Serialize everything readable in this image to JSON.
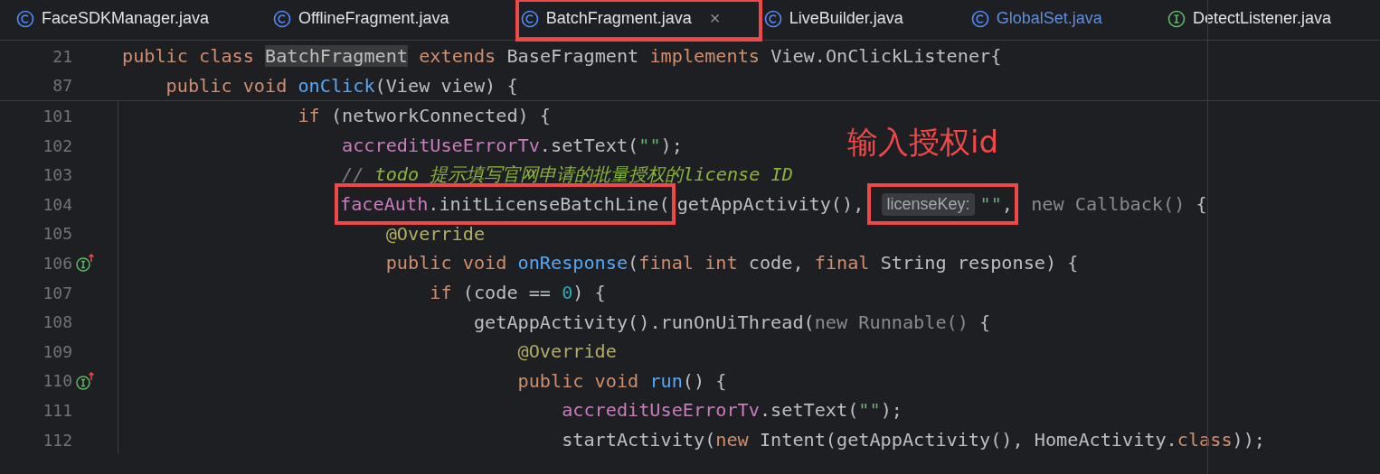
{
  "tabs": [
    {
      "label": "FaceSDKManager.java",
      "kind": "class",
      "selected": false,
      "modified": false,
      "annotated": false
    },
    {
      "label": "OfflineFragment.java",
      "kind": "class",
      "selected": false,
      "modified": false,
      "annotated": false
    },
    {
      "label": "BatchFragment.java",
      "kind": "class",
      "selected": true,
      "modified": false,
      "annotated": true,
      "close": "×"
    },
    {
      "label": "LiveBuilder.java",
      "kind": "class",
      "selected": false,
      "modified": false,
      "annotated": false
    },
    {
      "label": "GlobalSet.java",
      "kind": "class",
      "selected": false,
      "modified": true,
      "annotated": false
    },
    {
      "label": "DetectListener.java",
      "kind": "interface",
      "selected": false,
      "modified": false,
      "annotated": false
    }
  ],
  "sticky_lines": [
    {
      "number": "21",
      "tokens": [
        {
          "kind": "keyword",
          "text": "public class "
        },
        {
          "kind": "plain",
          "text": "BatchFragment",
          "highlighted": true
        },
        {
          "kind": "keyword",
          "text": " extends "
        },
        {
          "kind": "plain",
          "text": "BaseFragment"
        },
        {
          "kind": "keyword",
          "text": " implements "
        },
        {
          "kind": "plain",
          "text": "View.OnClickListener{"
        }
      ],
      "children": [
        {
          "number": "87",
          "tokens": [
            {
              "kind": "keyword",
              "text": "public void "
            },
            {
              "kind": "method",
              "text": "onClick"
            },
            {
              "kind": "plain",
              "text": "(View view) {"
            }
          ]
        }
      ]
    }
  ],
  "lines": [
    {
      "number": "101",
      "tokens": [
        {
          "kind": "keyword",
          "text": "if"
        },
        {
          "kind": "plain",
          "text": " (networkConnected) {"
        }
      ],
      "children": [
        {
          "number": "102",
          "tokens": [
            {
              "kind": "field",
              "text": "accreditUseErrorTv"
            },
            {
              "kind": "plain",
              "text": ".setText("
            },
            {
              "kind": "string",
              "text": "\"\""
            },
            {
              "kind": "plain",
              "text": ");"
            }
          ]
        },
        {
          "number": "103",
          "tokens": [
            {
              "kind": "comment",
              "text": "// "
            },
            {
              "kind": "todo",
              "text": "todo 提示填写官网申请的批量授权的license ID"
            }
          ]
        },
        {
          "number": "104",
          "tokens": [
            {
              "kind": "box",
              "tokens": [
                {
                  "kind": "field",
                  "text": "faceAuth"
                },
                {
                  "kind": "plain",
                  "text": ".initLicenseBatchLine("
                }
              ]
            },
            {
              "kind": "plain",
              "text": "getAppActivity(), "
            },
            {
              "kind": "box",
              "tokens": [
                {
                  "kind": "hint",
                  "text": "licenseKey:"
                },
                {
                  "kind": "string",
                  "text": "\"\""
                },
                {
                  "kind": "plain",
                  "text": ","
                }
              ]
            },
            {
              "kind": "muted",
              "text": " new Callback()"
            },
            {
              "kind": "plain",
              "text": " {"
            }
          ],
          "children": [
            {
              "number": "105",
              "tokens": [
                {
                  "kind": "annotation",
                  "text": "@Override"
                }
              ]
            },
            {
              "number": "106",
              "marker": true,
              "tokens": [
                {
                  "kind": "keyword",
                  "text": "public void "
                },
                {
                  "kind": "method",
                  "text": "onResponse"
                },
                {
                  "kind": "plain",
                  "text": "("
                },
                {
                  "kind": "keyword",
                  "text": "final int "
                },
                {
                  "kind": "plain",
                  "text": "code, "
                },
                {
                  "kind": "keyword",
                  "text": "final "
                },
                {
                  "kind": "plain",
                  "text": "String response) {"
                }
              ],
              "children": [
                {
                  "number": "107",
                  "tokens": [
                    {
                      "kind": "keyword",
                      "text": "if"
                    },
                    {
                      "kind": "plain",
                      "text": " (code == "
                    },
                    {
                      "kind": "number",
                      "text": "0"
                    },
                    {
                      "kind": "plain",
                      "text": ") {"
                    }
                  ],
                  "children": [
                    {
                      "number": "108",
                      "tokens": [
                        {
                          "kind": "plain",
                          "text": "getAppActivity().runOnUiThread("
                        },
                        {
                          "kind": "muted",
                          "text": "new Runnable()"
                        },
                        {
                          "kind": "plain",
                          "text": " {"
                        }
                      ],
                      "children": [
                        {
                          "number": "109",
                          "tokens": [
                            {
                              "kind": "annotation",
                              "text": "@Override"
                            }
                          ]
                        },
                        {
                          "number": "110",
                          "marker": true,
                          "tokens": [
                            {
                              "kind": "keyword",
                              "text": "public void "
                            },
                            {
                              "kind": "method",
                              "text": "run"
                            },
                            {
                              "kind": "plain",
                              "text": "() {"
                            }
                          ],
                          "children": [
                            {
                              "number": "111",
                              "tokens": [
                                {
                                  "kind": "field",
                                  "text": "accreditUseErrorTv"
                                },
                                {
                                  "kind": "plain",
                                  "text": ".setText("
                                },
                                {
                                  "kind": "string",
                                  "text": "\"\""
                                },
                                {
                                  "kind": "plain",
                                  "text": ");"
                                }
                              ]
                            },
                            {
                              "number": "112",
                              "tokens": [
                                {
                                  "kind": "plain",
                                  "text": "startActivity("
                                },
                                {
                                  "kind": "keyword",
                                  "text": "new "
                                },
                                {
                                  "kind": "plain",
                                  "text": "Intent(getAppActivity(), HomeActivity."
                                },
                                {
                                  "kind": "keyword",
                                  "text": "class"
                                },
                                {
                                  "kind": "plain",
                                  "text": "));"
                                }
                              ]
                            }
                          ]
                        }
                      ]
                    }
                  ]
                }
              ]
            }
          ]
        }
      ]
    }
  ],
  "note": "输入授权id"
}
